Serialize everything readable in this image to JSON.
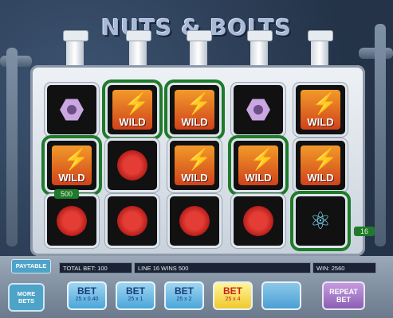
{
  "game": {
    "title": "NUTS & BOLTS"
  },
  "reels": {
    "rows": [
      [
        "nut",
        "wild",
        "wild",
        "nut",
        "wild"
      ],
      [
        "wild",
        "gear",
        "wild",
        "wild",
        "wild"
      ],
      [
        "gear",
        "gear",
        "gear",
        "gear",
        "atom"
      ]
    ],
    "wild_label": "WILD",
    "win_value": "500",
    "line_number": "16"
  },
  "status": {
    "paytable": "PAYTABLE",
    "total_bet": "TOTAL BET: 100",
    "line_win": "LINE 16 WINS 500",
    "win": "WIN: 2560"
  },
  "controls": {
    "more_bets": "MORE BETS",
    "bets": [
      {
        "label": "BET",
        "sub": "25 x 0.40"
      },
      {
        "label": "BET",
        "sub": "25 x 1"
      },
      {
        "label": "BET",
        "sub": "25 x 2"
      },
      {
        "label": "BET",
        "sub": "25 x 4"
      },
      {
        "label": "",
        "sub": ""
      }
    ],
    "repeat_bet": "REPEAT BET"
  },
  "colors": {
    "win_line": "#1f7a2a",
    "accent_bet": "#f0c92e",
    "repeat": "#8a5fb3"
  }
}
